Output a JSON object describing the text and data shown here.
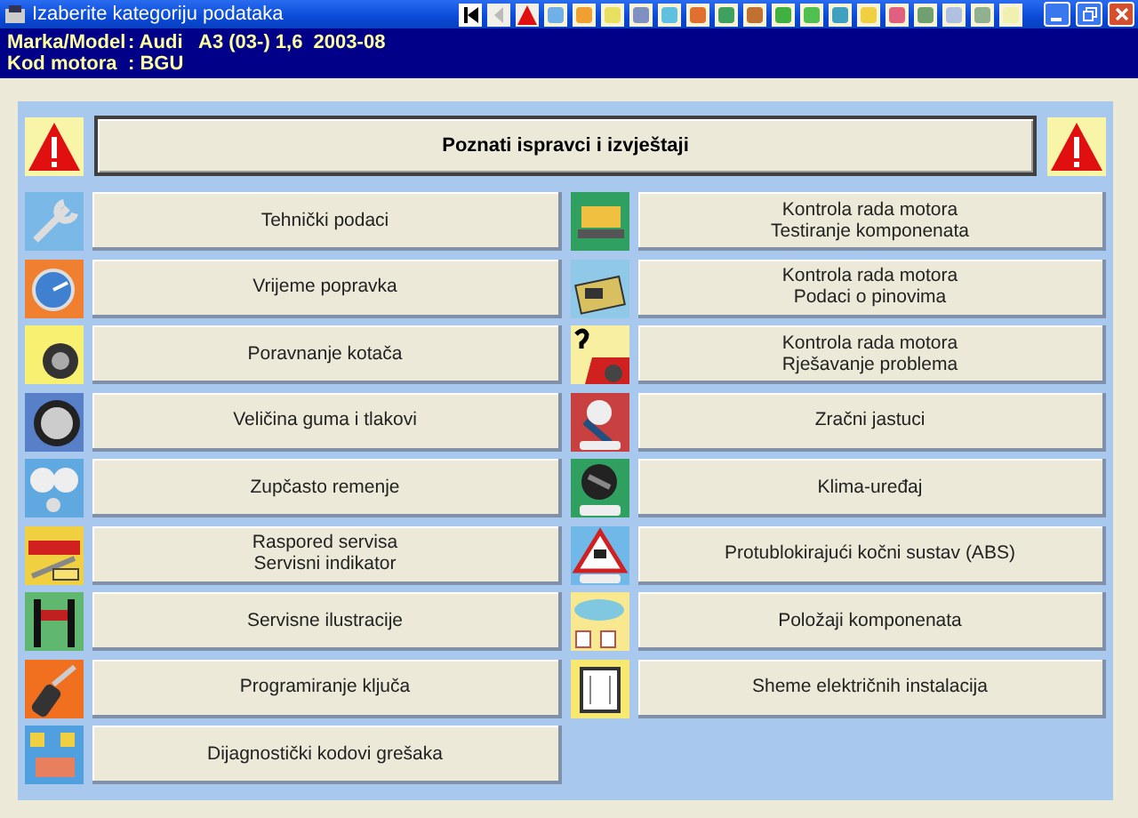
{
  "window": {
    "title": "Izaberite kategoriju podataka"
  },
  "vehicle_info": [
    {
      "label": "Marka/Model",
      "value": ": Audi   A3 (03-) 1,6  2003-08"
    },
    {
      "label": "Kod motora",
      "value": ": BGU"
    }
  ],
  "header_button": {
    "label": "Poznati ispravci i izvještaji"
  },
  "left_categories": [
    {
      "lines": [
        "Tehnički podaci"
      ]
    },
    {
      "lines": [
        "Vrijeme popravka"
      ]
    },
    {
      "lines": [
        "Poravnanje kotača"
      ]
    },
    {
      "lines": [
        "Veličina guma i tlakovi"
      ]
    },
    {
      "lines": [
        "Zupčasto remenje"
      ]
    },
    {
      "lines": [
        "Raspored servisa",
        "Servisni indikator"
      ]
    },
    {
      "lines": [
        "Servisne ilustracije"
      ]
    },
    {
      "lines": [
        "Programiranje ključa"
      ]
    },
    {
      "lines": [
        "Dijagnostički kodovi grešaka"
      ]
    }
  ],
  "right_categories": [
    {
      "lines": [
        "Kontrola rada motora",
        "Testiranje komponenata"
      ]
    },
    {
      "lines": [
        "Kontrola rada motora",
        "Podaci o pinovima"
      ]
    },
    {
      "lines": [
        "Kontrola rada motora",
        "Rješavanje problema"
      ]
    },
    {
      "lines": [
        "Zračni jastuci"
      ]
    },
    {
      "lines": [
        "Klima-uređaj"
      ]
    },
    {
      "lines": [
        "Protublokirajući kočni sustav (ABS)"
      ]
    },
    {
      "lines": [
        "Položaji komponenata"
      ]
    },
    {
      "lines": [
        "Sheme električnih instalacija"
      ]
    }
  ]
}
